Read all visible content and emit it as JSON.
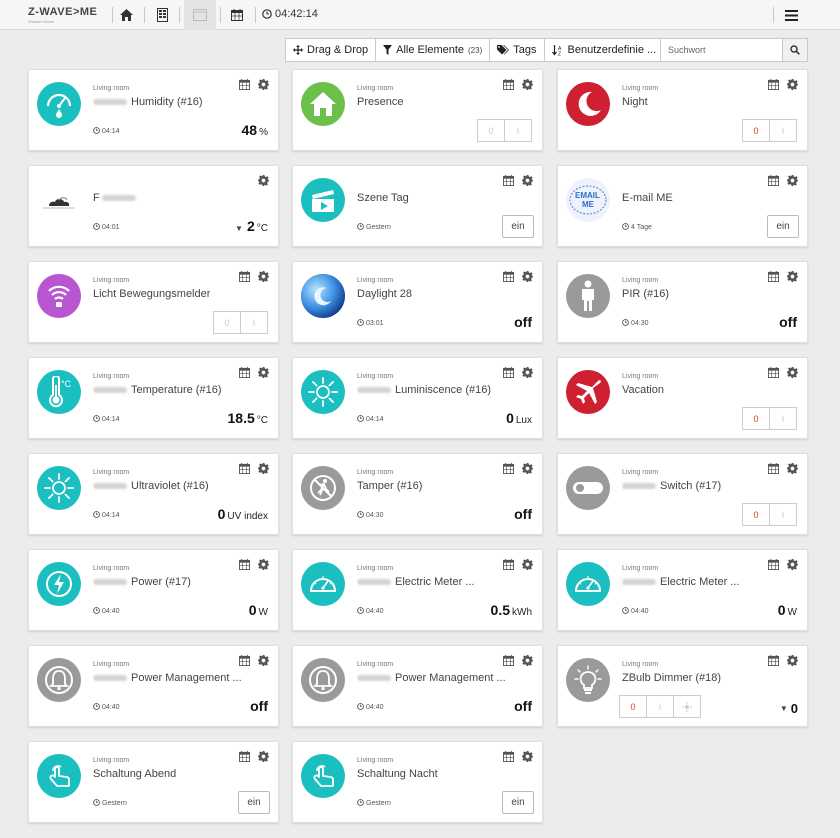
{
  "app": {
    "logo_text": "Z-WAVE>ME",
    "logo_subtitle": "Smarter Home",
    "clock": "04:42:14"
  },
  "toolbar_icons": [
    "home-icon",
    "rooms-icon",
    "elements-icon",
    "calendar-icon",
    "clock-icon",
    "menu-icon"
  ],
  "filters": [
    {
      "id": "dragdrop",
      "label": "Drag & Drop",
      "count": "",
      "icon": "arrows"
    },
    {
      "id": "alle",
      "label": "Alle Elemente",
      "count": "(23)",
      "icon": "filter"
    },
    {
      "id": "tags",
      "label": "Tags",
      "count": "",
      "icon": "tags"
    },
    {
      "id": "custom",
      "label": "Benutzerdefinie ...",
      "count": "",
      "icon": "sort"
    }
  ],
  "search": {
    "placeholder": "Suchwort",
    "value": ""
  },
  "colors": {
    "teal": "#1bbfbf",
    "green": "#6cc04a",
    "red": "#cf2031",
    "purple": "#b855d0",
    "grey": "#9a9a9a",
    "blue": "#2c6fd1"
  },
  "widgets": [
    {
      "location": "Living room",
      "title": "Humidity (#16)",
      "blurred": true,
      "time": "04:14",
      "value": "48",
      "unit": "%",
      "icon": "humidity-icon",
      "control": "value"
    },
    {
      "location": "Living room",
      "title": "Presence",
      "blurred": false,
      "time": "",
      "icon": "home-presence-icon",
      "control": "toggle",
      "off_label": "0",
      "on_label": "I",
      "active": "none"
    },
    {
      "location": "Living room",
      "title": "Night",
      "blurred": false,
      "time": "",
      "icon": "moon-icon",
      "control": "toggle",
      "off_label": "0",
      "on_label": "I",
      "active": "off"
    },
    {
      "location": "",
      "title": "F",
      "blurred_after": true,
      "time": "04:01",
      "value": "2",
      "unit": "°C",
      "trend": "down",
      "icon": "weather-icon",
      "control": "value",
      "calendar": false
    },
    {
      "location": "",
      "title": "Szene Tag",
      "blurred": false,
      "time": "Gestern",
      "icon": "scene-icon",
      "control": "ein",
      "button_label": "ein"
    },
    {
      "location": "",
      "title": "E-mail ME",
      "blurred": false,
      "time": "4 Tage",
      "icon": "email-me-icon",
      "control": "ein",
      "button_label": "ein"
    },
    {
      "location": "Living room",
      "title": "Licht Bewegungsmelder",
      "blurred": false,
      "time": "",
      "icon": "bulb-icon",
      "control": "toggle",
      "off_label": "0",
      "on_label": "I",
      "active": "none"
    },
    {
      "location": "Living room",
      "title": "Daylight 28",
      "blurred": false,
      "time": "03:01",
      "value": "off",
      "unit": "",
      "icon": "daylight-icon",
      "control": "value"
    },
    {
      "location": "Living room",
      "title": "PIR (#16)",
      "blurred": false,
      "time": "04:30",
      "value": "off",
      "unit": "",
      "icon": "person-icon",
      "control": "value"
    },
    {
      "location": "Living room",
      "title": "Temperature (#16)",
      "blurred": true,
      "time": "04:14",
      "value": "18.5",
      "unit": "°C",
      "icon": "thermometer-icon",
      "control": "value"
    },
    {
      "location": "Living room",
      "title": "Luminiscence (#16)",
      "blurred": true,
      "time": "04:14",
      "value": "0",
      "unit": "Lux",
      "icon": "sun-icon",
      "control": "value"
    },
    {
      "location": "Living room",
      "title": "Vacation",
      "blurred": false,
      "time": "",
      "icon": "airplane-icon",
      "control": "toggle",
      "off_label": "0",
      "on_label": "I",
      "active": "off"
    },
    {
      "location": "Living room",
      "title": "Ultraviolet (#16)",
      "blurred": true,
      "time": "04:14",
      "value": "0",
      "unit": "UV index",
      "icon": "sun-icon",
      "control": "value"
    },
    {
      "location": "Living room",
      "title": "Tamper (#16)",
      "blurred": false,
      "time": "04:30",
      "value": "off",
      "unit": "",
      "icon": "tamper-icon",
      "control": "value"
    },
    {
      "location": "Living room",
      "title": "Switch (#17)",
      "blurred": true,
      "time": "",
      "icon": "switch-icon",
      "control": "toggle",
      "off_label": "0",
      "on_label": "I",
      "active": "off"
    },
    {
      "location": "Living room",
      "title": "Power (#17)",
      "blurred": true,
      "time": "04:40",
      "value": "0",
      "unit": "W",
      "icon": "lightning-icon",
      "control": "value"
    },
    {
      "location": "Living room",
      "title": "Electric Meter ...",
      "blurred": true,
      "time": "04:40",
      "value": "0.5",
      "unit": "kWh",
      "icon": "meter-icon",
      "control": "value"
    },
    {
      "location": "Living room",
      "title": "Electric Meter ...",
      "blurred": true,
      "time": "04:40",
      "value": "0",
      "unit": "W",
      "icon": "meter-icon",
      "control": "value"
    },
    {
      "location": "Living room",
      "title": "Power Management ...",
      "blurred": true,
      "time": "04:40",
      "value": "off",
      "unit": "",
      "icon": "bell-icon",
      "control": "value"
    },
    {
      "location": "Living room",
      "title": "Power Management ...",
      "blurred": true,
      "time": "04:40",
      "value": "off",
      "unit": "",
      "icon": "bell-icon",
      "control": "value"
    },
    {
      "location": "Living room",
      "title": "ZBulb Dimmer (#18)",
      "blurred": false,
      "time": "",
      "icon": "dim-bulb-icon",
      "control": "dimmer",
      "off_label": "0",
      "on_label": "I",
      "value": "0"
    },
    {
      "location": "Living room",
      "title": "Schaltung Abend",
      "blurred": false,
      "time": "Gestern",
      "icon": "hand-icon",
      "control": "ein",
      "button_label": "ein"
    },
    {
      "location": "Living room",
      "title": "Schaltung Nacht",
      "blurred": false,
      "time": "Gestern",
      "icon": "hand-icon",
      "control": "ein",
      "button_label": "ein"
    }
  ]
}
